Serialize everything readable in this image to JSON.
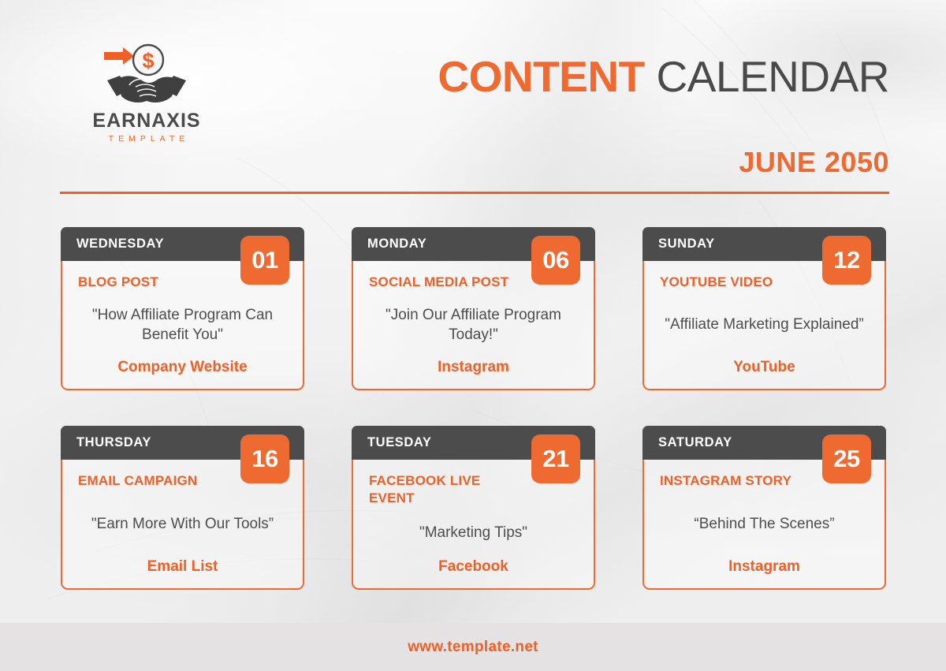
{
  "brand": {
    "logo_icon": "handshake-dollar-arrow-logo",
    "name": "EARNAXIS",
    "tagline": "TEMPLATE"
  },
  "header": {
    "title_strong": "CONTENT",
    "title_light": "CALENDAR",
    "subtitle": "JUNE 2050"
  },
  "colors": {
    "accent_orange": "#EF6A31",
    "accent_orange_dark": "#EF5F26",
    "header_gray": "#4C4C4C",
    "text_gray": "#4D4D4D",
    "footer_band": "#E4E2E3",
    "background": "#F4F4F4"
  },
  "cards": [
    {
      "day": "WEDNESDAY",
      "date": "01",
      "category": "BLOG POST",
      "quote": "\"How Affiliate Program Can Benefit You\"",
      "platform": "Company Website"
    },
    {
      "day": "MONDAY",
      "date": "06",
      "category": "SOCIAL MEDIA POST",
      "quote": "\"Join Our Affiliate Program Today!\"",
      "platform": "Instagram"
    },
    {
      "day": "SUNDAY",
      "date": "12",
      "category": "YOUTUBE VIDEO",
      "quote": "\"Affiliate Marketing Explained”",
      "platform": "YouTube"
    },
    {
      "day": "THURSDAY",
      "date": "16",
      "category": "EMAIL CAMPAIGN",
      "quote": "\"Earn More With Our Tools”",
      "platform": "Email List"
    },
    {
      "day": "TUESDAY",
      "date": "21",
      "category": "FACEBOOK LIVE EVENT",
      "quote": "\"Marketing Tips\"",
      "platform": "Facebook"
    },
    {
      "day": "SATURDAY",
      "date": "25",
      "category": "INSTAGRAM STORY",
      "quote": "“Behind The Scenes”",
      "platform": "Instagram"
    }
  ],
  "footer": {
    "link": "www.template.net"
  }
}
